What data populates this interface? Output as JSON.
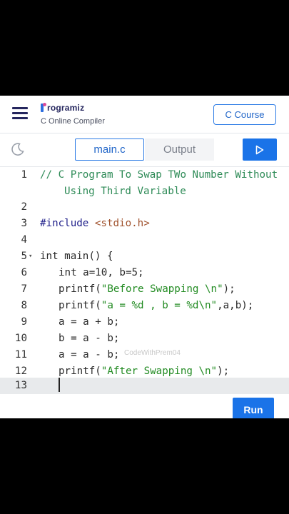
{
  "header": {
    "logo_text": "rogramiz",
    "subtitle": "C Online Compiler",
    "course_button": "C Course"
  },
  "toolbar": {
    "tab_main": "main.c",
    "tab_output": "Output"
  },
  "editor": {
    "line_numbers": [
      "1",
      "2",
      "3",
      "4",
      "5",
      "6",
      "7",
      "8",
      "9",
      "10",
      "11",
      "12",
      "13"
    ],
    "lines": {
      "l1a": "// C Program To Swap TWo Number Without",
      "l1b": "Using Third Variable",
      "l3_inc": "#include ",
      "l3_hdr": "<stdio.h>",
      "l5": "int main() {",
      "l6": "int a=10, b=5;",
      "l7_fn": "printf(",
      "l7_str": "\"Before Swapping \\n\"",
      "l7_end": ");",
      "l8_fn": "printf(",
      "l8_str": "\"a = %d , b = %d\\n\"",
      "l8_end": ",a,b);",
      "l9": "a = a + b;",
      "l10": "b = a - b;",
      "l11": "a = a - b;",
      "l12_fn": "printf(",
      "l12_str": "\"After Swapping \\n\"",
      "l12_end": ");"
    },
    "watermark": "CodeWithPrem04",
    "active_line": 13
  },
  "run_button": "Run",
  "colors": {
    "accent": "#1a73e8",
    "comment": "#2e8b57",
    "string": "#228b22",
    "header_file": "#a0522d"
  }
}
